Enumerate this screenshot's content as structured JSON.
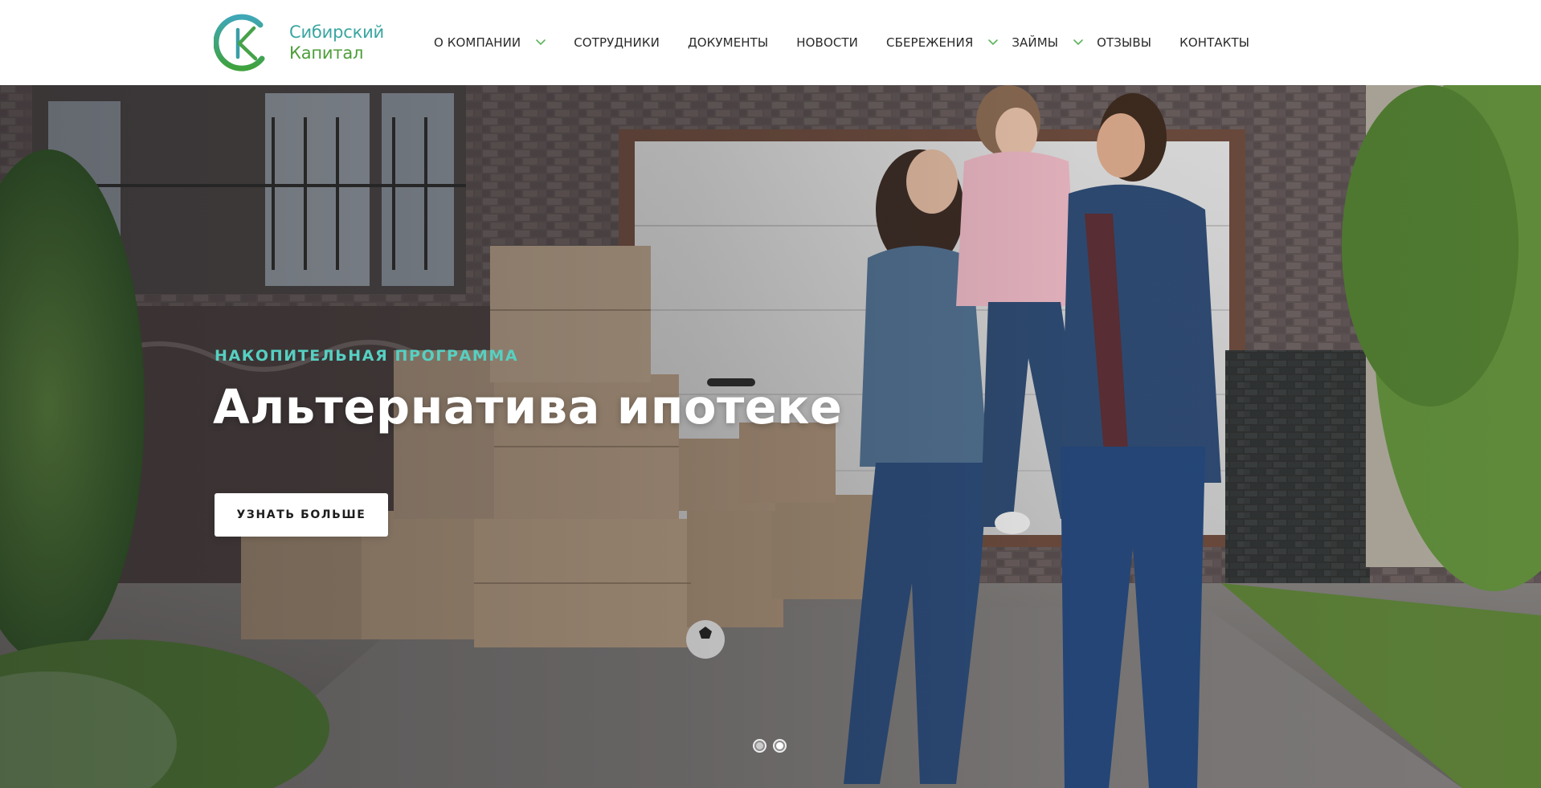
{
  "brand": {
    "name_line1": "Сибирский",
    "name_line2": "Капитал",
    "monogram_letter": "К",
    "colors": {
      "teal": "#3aa6a0",
      "green": "#4d9e3a"
    }
  },
  "nav": {
    "items": [
      {
        "label": "О КОМПАНИИ",
        "has_dropdown": true
      },
      {
        "label": "СОТРУДНИКИ",
        "has_dropdown": false
      },
      {
        "label": "ДОКУМЕНТЫ",
        "has_dropdown": false
      },
      {
        "label": "НОВОСТИ",
        "has_dropdown": false
      },
      {
        "label": "СБЕРЕЖЕНИЯ",
        "has_dropdown": true
      },
      {
        "label": "ЗАЙМЫ",
        "has_dropdown": true
      },
      {
        "label": "ОТЗЫВЫ",
        "has_dropdown": false
      },
      {
        "label": "КОНТАКТЫ",
        "has_dropdown": false
      }
    ],
    "chevron_icon": "chevron-down-icon",
    "chevron_color": "#5bb45a"
  },
  "hero": {
    "kicker": "НАКОПИТЕЛЬНАЯ ПРОГРАММА",
    "title": "Альтернатива ипотеке",
    "button_label": "УЗНАТЬ БОЛЬШЕ",
    "kicker_color": "#56d0c2",
    "slides_total": 2,
    "active_slide": 2
  }
}
